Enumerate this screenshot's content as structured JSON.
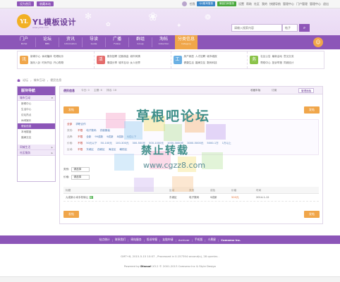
{
  "topbar": {
    "left_pills": [
      "设为首页",
      "收藏本站"
    ],
    "right_links": [
      "任我",
      "QQ账号登录",
      "微信扫码登录",
      "设置",
      "帮助",
      "社区",
      "我的",
      "快捷导航",
      "管理中心",
      "门户管理",
      "管理中心",
      "退出"
    ]
  },
  "header": {
    "logo_badge": "YL",
    "logo_text": "YL模板设计",
    "logo_sub": "www.ylmb.com",
    "search_placeholder": "请输入搜索内容",
    "search_scope": "帖子"
  },
  "nav": {
    "items": [
      {
        "cn": "门户",
        "en": "Portal"
      },
      {
        "cn": "论坛",
        "en": "BBS"
      },
      {
        "cn": "资讯",
        "en": "Information"
      },
      {
        "cn": "导读",
        "en": "Guide"
      },
      {
        "cn": "广播",
        "en": "Follow"
      },
      {
        "cn": "群组",
        "en": "Group"
      },
      {
        "cn": "淘帖",
        "en": "Collection"
      },
      {
        "cn": "分类信息",
        "en": "Category"
      }
    ],
    "active_index": 7
  },
  "quick_links": [
    {
      "icon": "讯",
      "color": "#f0a64a",
      "links": [
        "新闻中心",
        "休闲播体",
        "吃喝玩乐",
        "娱乐八卦",
        "时尚节目",
        "开心购物"
      ]
    },
    {
      "icon": "活",
      "color": "#e46b6b",
      "links": [
        "服务招聘",
        "招致佣金",
        "城市风情",
        "情感分享",
        "城市互动",
        "女人世界"
      ]
    },
    {
      "icon": "工",
      "color": "#6bb0e4",
      "links": [
        "房产家居",
        "人才招聘",
        "城市墙报",
        "健康生活",
        "婚嫁交友",
        "数码科技"
      ]
    },
    {
      "icon": "务",
      "color": "#8bc34a",
      "links": [
        "社区公告",
        "最新活动",
        "意见交流",
        "帮助中心",
        "投诉举报",
        "同城设计"
      ]
    }
  ],
  "breadcrumb": [
    "论坛",
    "城市互动",
    "便民信息"
  ],
  "sidebar": {
    "title": "版块导航",
    "groups": [
      {
        "label": "城市互动",
        "items": [
          "新闻中心",
          "生活中心",
          "论坛热点",
          "休闲娱乐",
          "便民信息",
          "本地楼盘",
          "婚嫁交友"
        ],
        "active_item": 4
      },
      {
        "label": "同城生活",
        "items": []
      },
      {
        "label": "社区服务",
        "items": []
      }
    ]
  },
  "content": {
    "tab_title": "便民信息",
    "stats": [
      "今日: 0",
      "主题: 6",
      "排名: 18"
    ],
    "actions": [
      "收藏本版",
      "订阅"
    ],
    "manage_label": "管理面板",
    "post_button": "发帖",
    "filter": {
      "rows": [
        {
          "label": "全部",
          "options": [
            "求职合作"
          ],
          "selected": "全部"
        },
        {
          "label": "类别:",
          "options": [
            "不限",
            "电子数码",
            "衣服服装"
          ],
          "selected": "不限"
        },
        {
          "label": "品牌:",
          "options": [
            "不限",
            "全新",
            "99成新",
            "9成新",
            "8成新",
            "8成以下"
          ],
          "selected": "不限"
        },
        {
          "label": "价格:",
          "options": [
            "不限",
            "50元以下",
            "50-100元",
            "100-300元",
            "300-500元",
            "500-1000元",
            "1000-3000元",
            "3000-5000元",
            "5000-1万",
            "1万以上"
          ],
          "selected": "不限"
        },
        {
          "label": "区域:",
          "options": [
            "不限",
            "东城区",
            "西城区",
            "海淀区",
            "朝阳区"
          ],
          "selected": "不限"
        }
      ]
    },
    "dropdowns": [
      {
        "label": "类别:",
        "value": "请选择"
      },
      {
        "label": "价格:",
        "value": "请选择"
      }
    ],
    "table": {
      "headers": [
        "标题",
        "区域",
        "类别",
        "成色",
        "价格",
        "时间"
      ],
      "rows": [
        {
          "title": "九成新小米手机转让",
          "badge": "新",
          "region": "东城区",
          "category": "电子数码",
          "condition": "9成新",
          "price": "500元",
          "time": "2014-1-12"
        }
      ]
    },
    "post_button_bottom": "发帖"
  },
  "watermark": {
    "title": "草根吧论坛",
    "subtitle": "禁止转载",
    "url": "www.cgzz8.com"
  },
  "footer": {
    "links": [
      "站点统计",
      "联系我们",
      "网站服务",
      "投诉举报",
      "友链申请",
      "Archiver",
      "手机版",
      "小黑屋"
    ],
    "brand_tail": "Comsenz Inc.",
    "line1": "GMT+8, 2015-5-15 10:07 , Processed in 0.157394 second(s), 28 queries .",
    "line2_prefix": "Powered by",
    "line2_brand": "Discuz!",
    "line2_suffix": "X3.2 © 2001-2013 Comsenz Inc & Style Design"
  }
}
